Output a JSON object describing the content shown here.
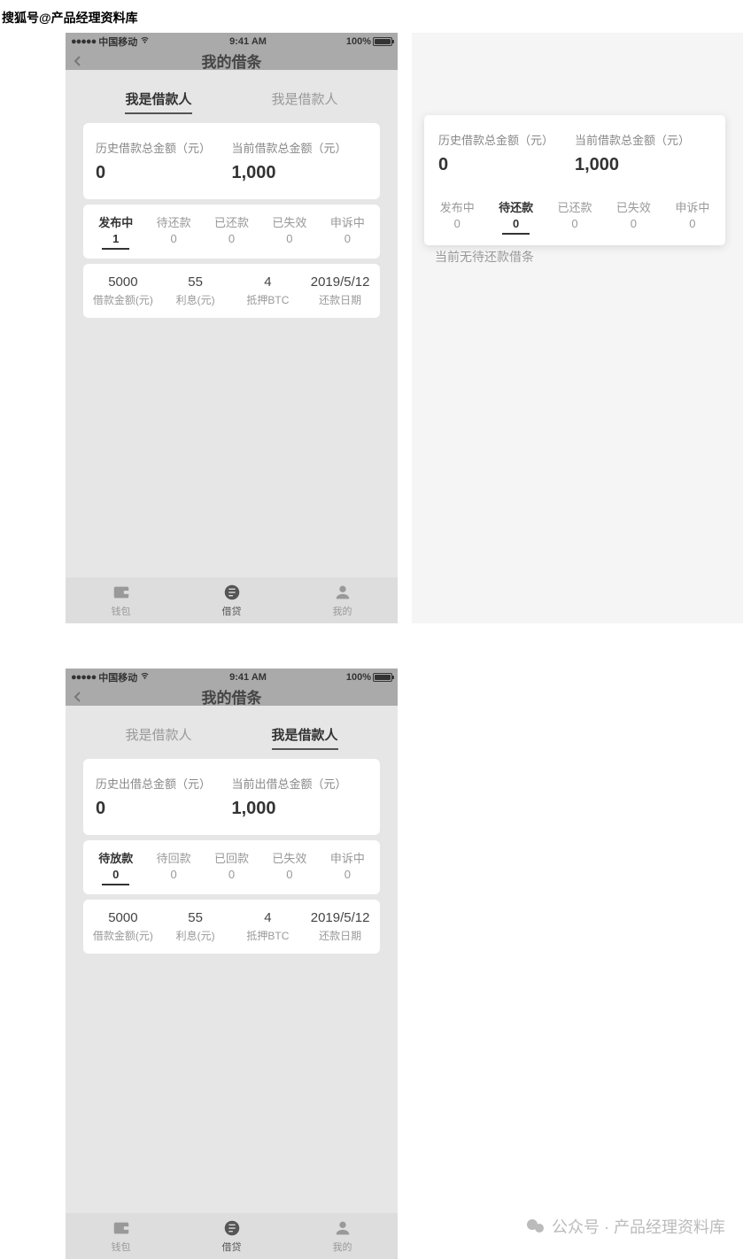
{
  "watermark_top": "搜狐号@产品经理资料库",
  "watermark_bottom": "公众号 · 产品经理资料库",
  "status": {
    "carrier": "中国移动",
    "time": "9:41 AM",
    "battery": "100%"
  },
  "nav_title": "我的借条",
  "role_tabs": {
    "borrower": "我是借款人",
    "lender": "我是借款人"
  },
  "s1": {
    "amt1_lbl": "历史借款总金额（元）",
    "amt1_val": "0",
    "amt2_lbl": "当前借款总金额（元）",
    "amt2_val": "1,000",
    "stats": [
      {
        "lbl": "发布中",
        "val": "1"
      },
      {
        "lbl": "待还款",
        "val": "0"
      },
      {
        "lbl": "已还款",
        "val": "0"
      },
      {
        "lbl": "已失效",
        "val": "0"
      },
      {
        "lbl": "申诉中",
        "val": "0"
      }
    ],
    "detail": [
      {
        "val": "5000",
        "lbl": "借款金额(元)"
      },
      {
        "val": "55",
        "lbl": "利息(元)"
      },
      {
        "val": "4",
        "lbl": "抵押BTC"
      },
      {
        "val": "2019/5/12",
        "lbl": "还款日期"
      }
    ]
  },
  "s2": {
    "amt1_lbl": "历史借款总金额（元）",
    "amt1_val": "0",
    "amt2_lbl": "当前借款总金额（元）",
    "amt2_val": "1,000",
    "stats": [
      {
        "lbl": "发布中",
        "val": "0"
      },
      {
        "lbl": "待还款",
        "val": "0"
      },
      {
        "lbl": "已还款",
        "val": "0"
      },
      {
        "lbl": "已失效",
        "val": "0"
      },
      {
        "lbl": "申诉中",
        "val": "0"
      }
    ],
    "empty": "当前无待还款借条"
  },
  "s3": {
    "amt1_lbl": "历史出借总金额（元）",
    "amt1_val": "0",
    "amt2_lbl": "当前出借总金额（元）",
    "amt2_val": "1,000",
    "stats": [
      {
        "lbl": "待放款",
        "val": "0"
      },
      {
        "lbl": "待回款",
        "val": "0"
      },
      {
        "lbl": "已回款",
        "val": "0"
      },
      {
        "lbl": "已失效",
        "val": "0"
      },
      {
        "lbl": "申诉中",
        "val": "0"
      }
    ],
    "detail": [
      {
        "val": "5000",
        "lbl": "借款金额(元)"
      },
      {
        "val": "55",
        "lbl": "利息(元)"
      },
      {
        "val": "4",
        "lbl": "抵押BTC"
      },
      {
        "val": "2019/5/12",
        "lbl": "还款日期"
      }
    ]
  },
  "tabbar": {
    "wallet": "钱包",
    "loan": "借贷",
    "mine": "我的"
  }
}
